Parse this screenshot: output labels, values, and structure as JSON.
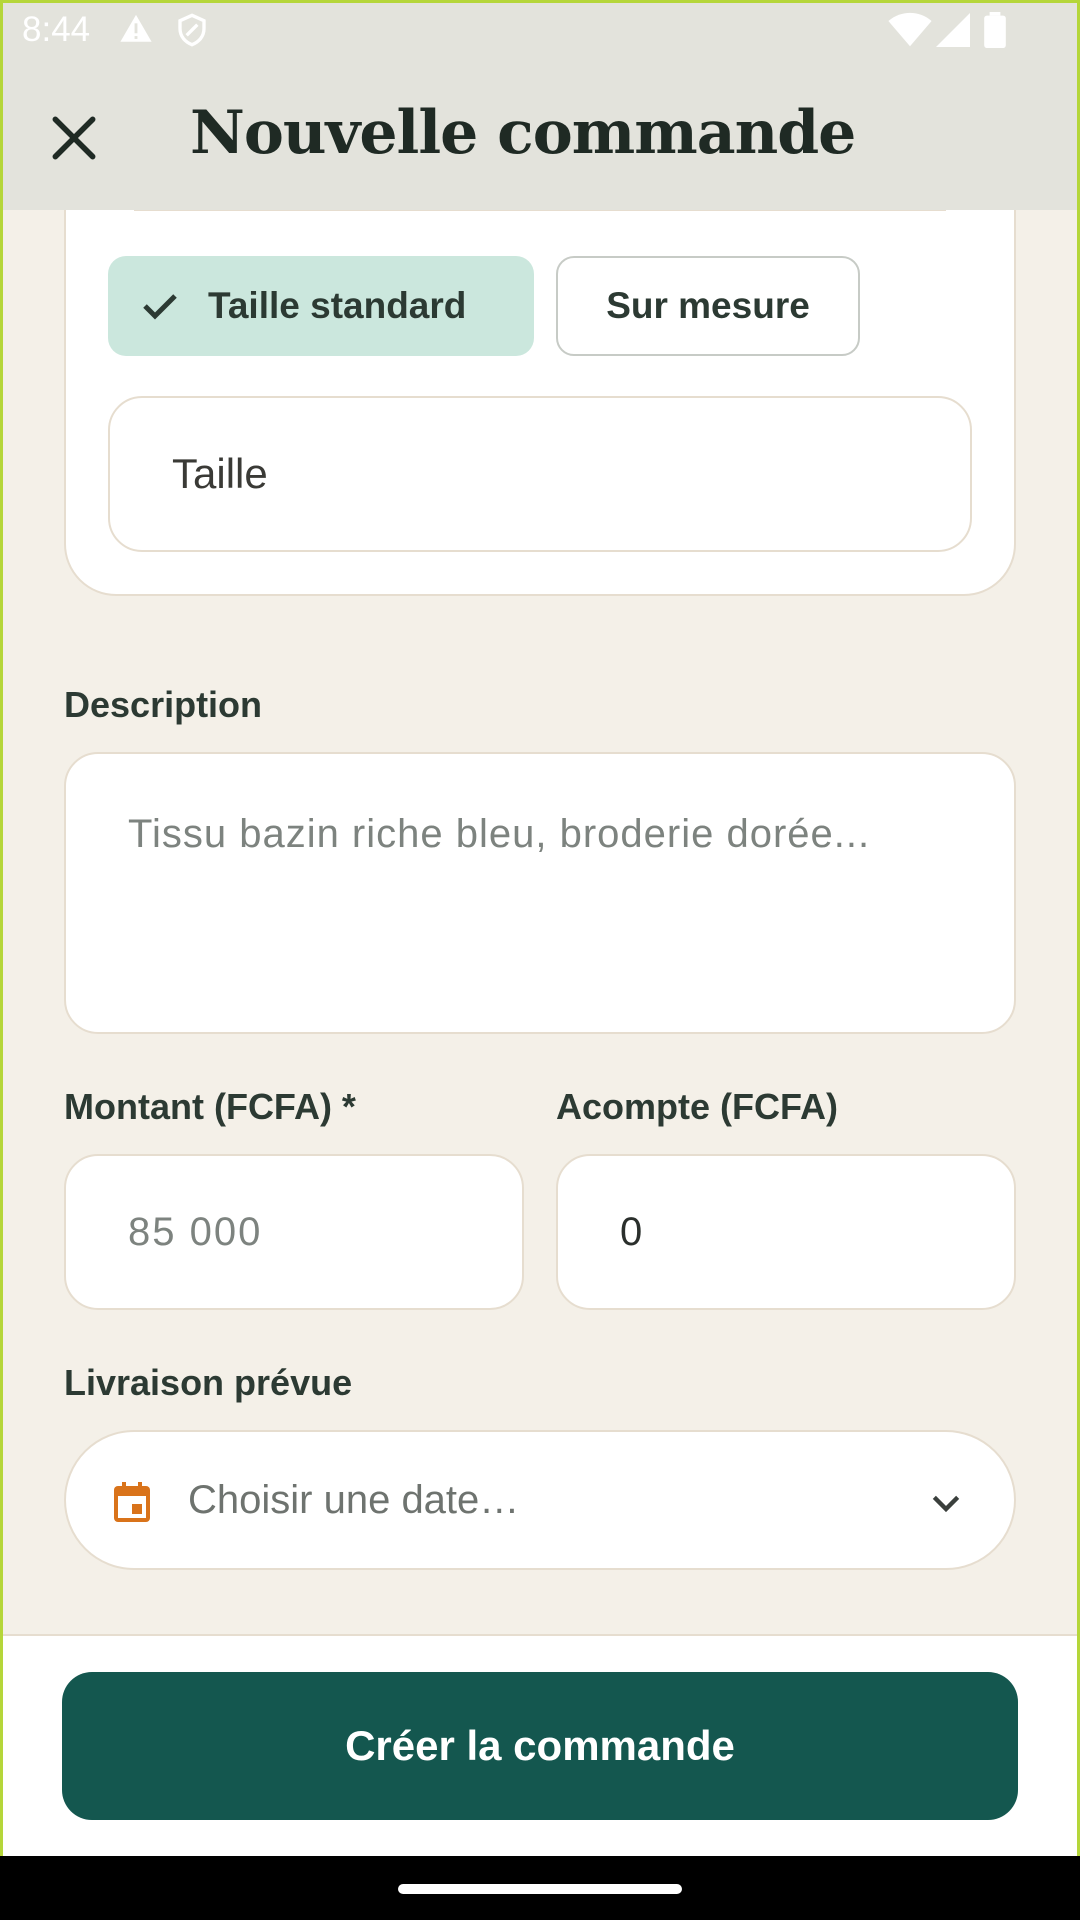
{
  "status_bar": {
    "time": "8:44"
  },
  "app_bar": {
    "title": "Nouvelle commande"
  },
  "size_section": {
    "options": [
      {
        "label": "Taille standard",
        "selected": true
      },
      {
        "label": "Sur mesure",
        "selected": false
      }
    ],
    "size_field": {
      "placeholder": "Taille"
    }
  },
  "description": {
    "label": "Description",
    "placeholder": "Tissu bazin riche bleu, broderie dorée..."
  },
  "amount": {
    "label": "Montant (FCFA) *",
    "placeholder": "85 000"
  },
  "deposit": {
    "label": "Acompte (FCFA)",
    "value": "0"
  },
  "delivery": {
    "label": "Livraison prévue",
    "placeholder": "Choisir une date…"
  },
  "submit": {
    "label": "Créer la commande"
  },
  "colors": {
    "primary": "#14574f",
    "chip_selected": "#cbe7dd",
    "background": "#f4f0e8",
    "calendar_accent": "#d9731a"
  }
}
